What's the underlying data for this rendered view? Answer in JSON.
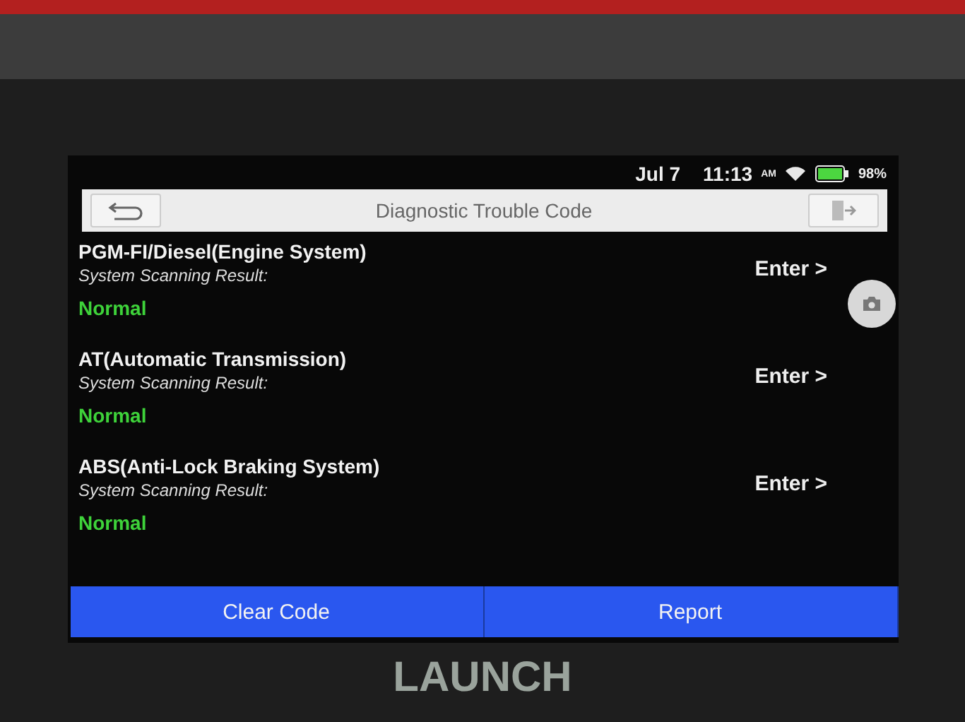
{
  "status_bar": {
    "date": "Jul 7",
    "time": "11:13",
    "meridiem": "AM",
    "battery": "98%"
  },
  "header": {
    "title": "Diagnostic Trouble Code"
  },
  "systems": [
    {
      "name": "PGM-FI/Diesel(Engine System)",
      "label": "System Scanning Result:",
      "result": "Normal",
      "action": "Enter >"
    },
    {
      "name": "AT(Automatic Transmission)",
      "label": "System Scanning Result:",
      "result": "Normal",
      "action": "Enter >"
    },
    {
      "name": "ABS(Anti-Lock Braking System)",
      "label": "System Scanning Result:",
      "result": "Normal",
      "action": "Enter >"
    }
  ],
  "buttons": [
    "Clear Code",
    "Report"
  ],
  "device": {
    "brand": "LAUNCH"
  }
}
